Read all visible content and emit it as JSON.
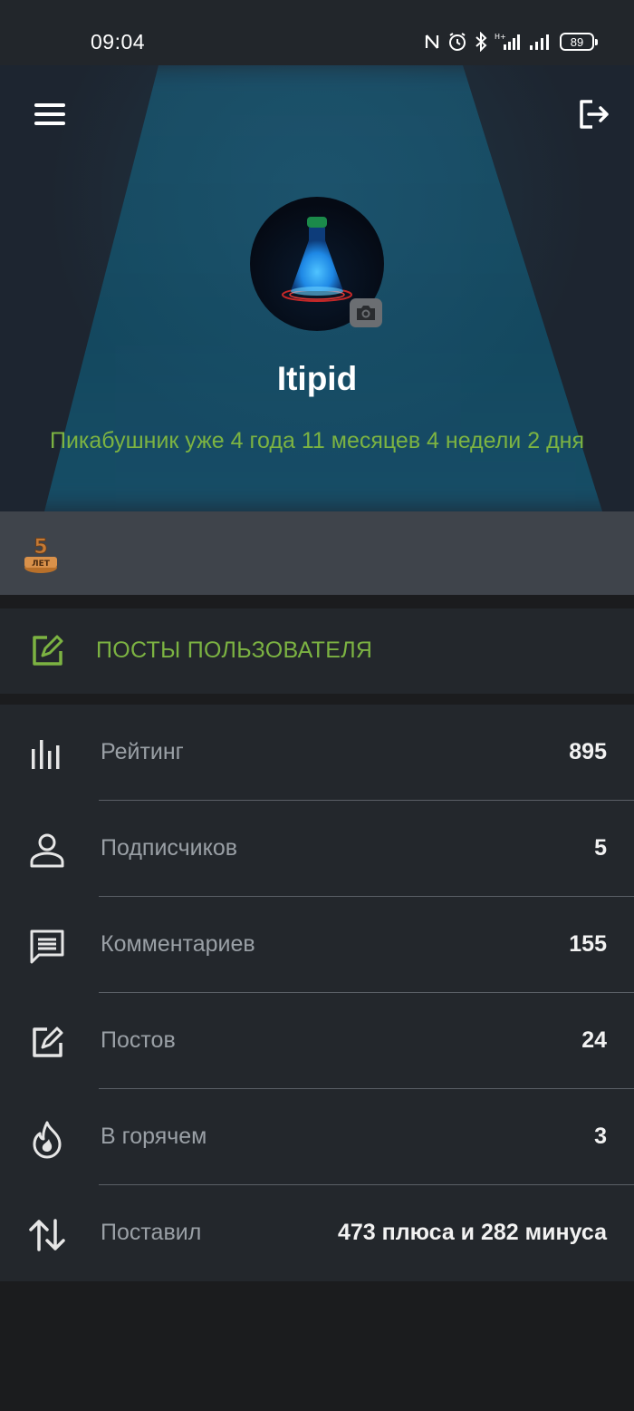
{
  "status_bar": {
    "time": "09:04",
    "battery": "89",
    "icons": [
      "nfc-icon",
      "alarm-icon",
      "bluetooth-icon",
      "signal-h-plus-icon",
      "signal-icon",
      "battery-icon"
    ]
  },
  "header": {
    "username": "Itipid",
    "tenure": "Пикабушник уже 4 года 11 месяцев 4 недели 2 дня"
  },
  "awards": {
    "badges": [
      {
        "name": "5-years-award",
        "text": "5 ЛЕТ"
      }
    ]
  },
  "posts_section": {
    "label": "ПОСТЫ ПОЛЬЗОВАТЕЛЯ"
  },
  "stats": [
    {
      "label": "Рейтинг",
      "value": "895",
      "icon": "rating-bars-icon"
    },
    {
      "label": "Подписчиков",
      "value": "5",
      "icon": "person-icon"
    },
    {
      "label": "Комментариев",
      "value": "155",
      "icon": "comment-icon"
    },
    {
      "label": "Постов",
      "value": "24",
      "icon": "edit-icon"
    },
    {
      "label": "В горячем",
      "value": "3",
      "icon": "fire-icon"
    },
    {
      "label": "Поставил",
      "value": "473 плюса и 282 минуса",
      "icon": "up-down-arrows-icon"
    }
  ],
  "colors": {
    "accent_green": "#7cb342",
    "panel": "#23272c",
    "awards_strip": "#3f444b"
  }
}
